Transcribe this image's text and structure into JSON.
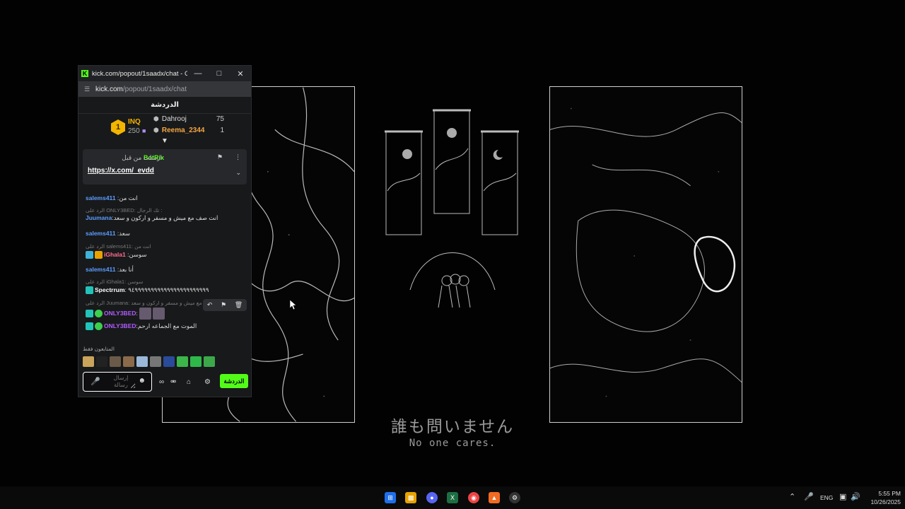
{
  "window": {
    "title": "kick.com/popout/1saadx/chat - Goo...",
    "url_host": "kick.com",
    "url_path": "/popout/1saadx/chat",
    "icons": {
      "minimize": "minimize-icon",
      "maximize": "maximize-icon",
      "close": "close-icon"
    }
  },
  "chat_header": {
    "title": "الدردشة"
  },
  "leaderboard": {
    "rank": "1",
    "top_name": "INQ",
    "top_count": "250",
    "rows": [
      {
        "name": "Dahrooj",
        "count": "75"
      },
      {
        "name": "Reema_2344",
        "count": "1"
      }
    ]
  },
  "pinned": {
    "meta": "ارسلت من قبل",
    "user": "BotRix",
    "link": "https://x.com/_evdd"
  },
  "messages": [
    {
      "user": "salems411",
      "text": " :انت من",
      "color": "#5c9dff"
    },
    {
      "reply": "الرد على ONLY3BED: تك الرجال :"
    },
    {
      "user": "Juumana",
      "text": ":انت صف مع ميش و مسفر و اركون و سعد",
      "color": "#5c9dff"
    },
    {
      "user": "salems411",
      "text": " :سعد",
      "color": "#5c9dff"
    },
    {
      "reply": "الرد على salems411: انت من"
    },
    {
      "user": "iGhala1",
      "text": " :سوسن",
      "color": "#ff6f91"
    },
    {
      "user": "salems411",
      "text": " :أنا بعد",
      "color": "#5c9dff"
    },
    {
      "reply": "الرد على iGhala1: سوسن"
    },
    {
      "user": "Spectrrum",
      "text": ": ٩٤٩٩٩٩٩٩٩٩٩٩٩٩٩٩٩٩٩٩٩٩٩٩٩",
      "color": "#ffffff"
    },
    {
      "reply": "الرد على Juumana: انت صف مع ميش و مسفر و اركون و سعد"
    },
    {
      "user": "ONLY3BED",
      "text": ":",
      "color": "#b05cff"
    },
    {
      "user": "ONLY3BED",
      "text": ":الموت مع الجماعه ارحم",
      "color": "#b05cff"
    }
  ],
  "emotes": {
    "label": "المتابعون فقط"
  },
  "composer": {
    "placeholder": "إرسال رسالة",
    "send_label": "الدردشة"
  },
  "wallpaper": {
    "caption_jp": "誰も問いません",
    "caption_en": "No one cares."
  },
  "taskbar": {
    "lang": "ENG",
    "time": "5:55 PM",
    "date": "10/26/2025"
  }
}
